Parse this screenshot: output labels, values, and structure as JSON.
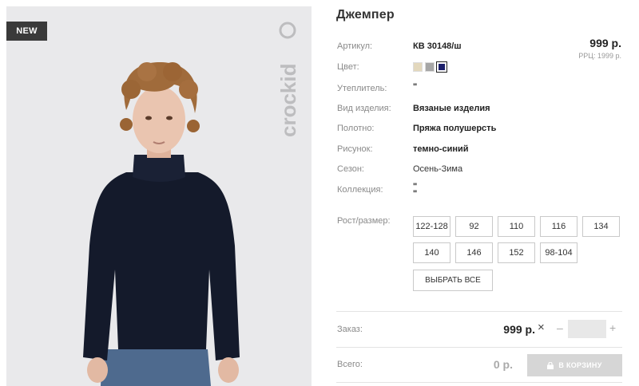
{
  "badge": "NEW",
  "brand_watermark": "crockid",
  "product": {
    "title": "Джемпер",
    "price": "999 р.",
    "rrp": "РРЦ: 1999 р."
  },
  "attributes": [
    {
      "label": "Артикул:",
      "value": "КВ 30148/ш"
    },
    {
      "label": "Цвет:"
    },
    {
      "label": "Утеплитель:",
      "value": "\""
    },
    {
      "label": "Вид изделия:",
      "value": "Вязаные изделия"
    },
    {
      "label": "Полотно:",
      "value": "Пряжа полушерсть"
    },
    {
      "label": "Рисунок:",
      "value": "темно-синий"
    },
    {
      "label": "Сезон:",
      "value": "Осень-Зима"
    },
    {
      "label": "Коллекция:",
      "value": "\"\n\""
    }
  ],
  "colors": [
    {
      "hex": "#e3d8bd",
      "selected": false
    },
    {
      "hex": "#a6a6a6",
      "selected": false
    },
    {
      "hex": "#1c1f6b",
      "selected": true
    }
  ],
  "size_label": "Рост/размер:",
  "sizes": [
    "122-128",
    "92",
    "110",
    "116",
    "134",
    "140",
    "146",
    "152",
    "98-104"
  ],
  "select_all_label": "ВЫБРАТЬ ВСЕ",
  "order": {
    "label": "Заказ:",
    "price": "999 р.",
    "remove_icon": "×",
    "minus": "–",
    "plus": "+",
    "quantity": ""
  },
  "total": {
    "label": "Всего:",
    "value": "0 р.",
    "cart_button": "В КОРЗИНУ"
  }
}
